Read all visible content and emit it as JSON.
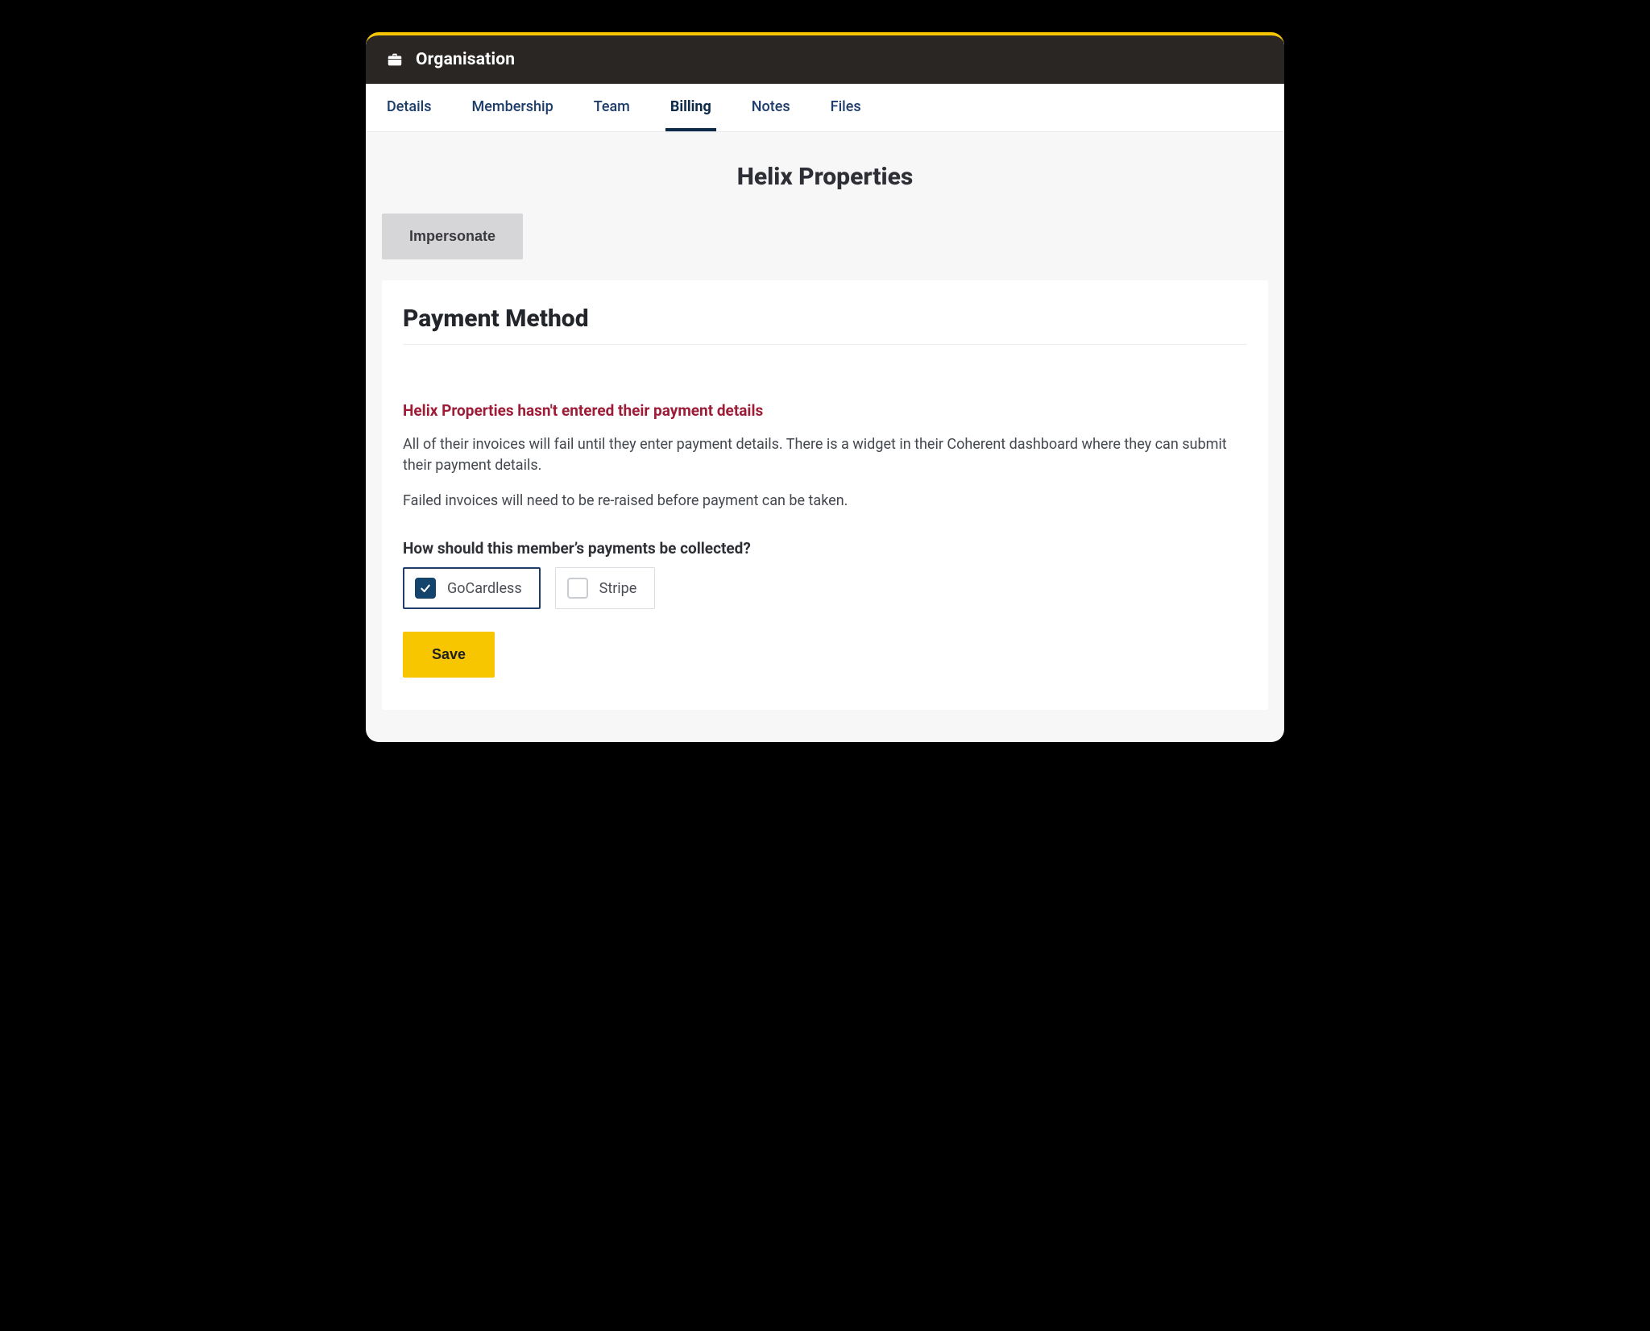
{
  "header": {
    "title": "Organisation"
  },
  "tabs": [
    {
      "label": "Details",
      "active": false
    },
    {
      "label": "Membership",
      "active": false
    },
    {
      "label": "Team",
      "active": false
    },
    {
      "label": "Billing",
      "active": true
    },
    {
      "label": "Notes",
      "active": false
    },
    {
      "label": "Files",
      "active": false
    }
  ],
  "page": {
    "org_name": "Helix Properties",
    "impersonate_label": "Impersonate"
  },
  "card": {
    "title": "Payment Method",
    "warning": "Helix Properties hasn't entered their payment details",
    "body1": "All of their invoices will fail until they enter payment details. There is a widget in their Coherent dashboard where they can submit their payment details.",
    "body2": "Failed invoices will need to be re-raised before payment can be taken.",
    "question": "How should this member’s payments be collected?",
    "options": [
      {
        "label": "GoCardless",
        "selected": true
      },
      {
        "label": "Stripe",
        "selected": false
      }
    ],
    "save_label": "Save"
  },
  "colors": {
    "accent_yellow": "#f7c600",
    "tab_link": "#1e3d6b",
    "warning_text": "#9d1c37",
    "checkbox_fill": "#14446b"
  }
}
